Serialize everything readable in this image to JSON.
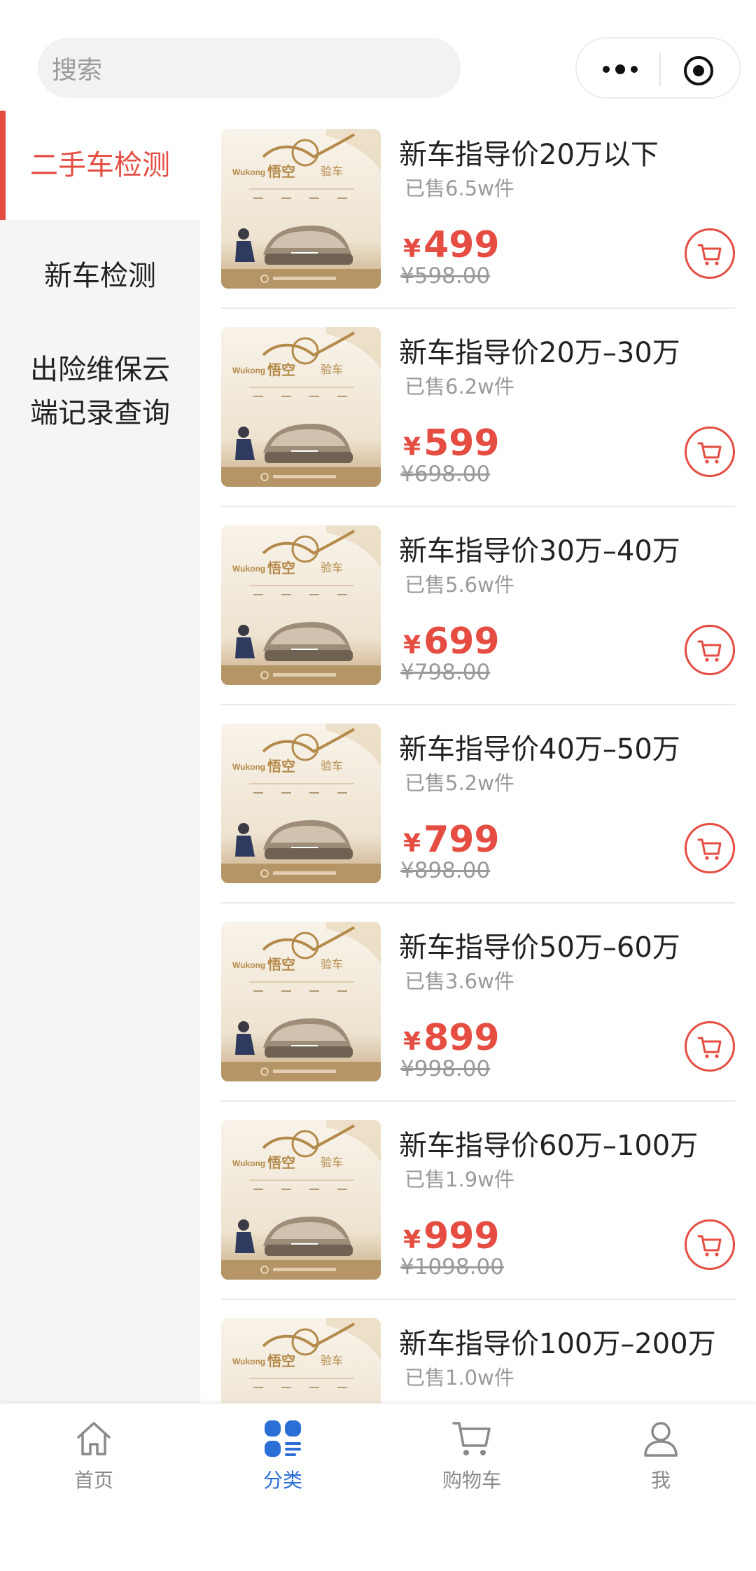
{
  "search": {
    "placeholder": "搜索"
  },
  "capsule": {
    "more_icon": "more-dots-icon",
    "close_icon": "target-icon"
  },
  "sidebar": {
    "items": [
      {
        "label": "二手车检测",
        "active": true
      },
      {
        "label": "新车检测",
        "active": false
      },
      {
        "label": "出险维保云端记录查询",
        "line1": "出险维保云",
        "line2": "端记录查询",
        "active": false
      }
    ]
  },
  "products": [
    {
      "title": "新车指导价20万以下",
      "sold": "已售6.5w件",
      "currency": "¥",
      "price": "499",
      "original": "¥598.00"
    },
    {
      "title": "新车指导价20万–30万",
      "sold": "已售6.2w件",
      "currency": "¥",
      "price": "599",
      "original": "¥698.00"
    },
    {
      "title": "新车指导价30万–40万",
      "sold": "已售5.6w件",
      "currency": "¥",
      "price": "699",
      "original": "¥798.00"
    },
    {
      "title": "新车指导价40万–50万",
      "sold": "已售5.2w件",
      "currency": "¥",
      "price": "799",
      "original": "¥898.00"
    },
    {
      "title": "新车指导价50万–60万",
      "sold": "已售3.6w件",
      "currency": "¥",
      "price": "899",
      "original": "¥998.00"
    },
    {
      "title": "新车指导价60万–100万",
      "sold": "已售1.9w件",
      "currency": "¥",
      "price": "999",
      "original": "¥1098.00"
    },
    {
      "title": "新车指导价100万–200万",
      "sold": "已售1.0w件",
      "currency": "¥",
      "price": "",
      "original": ""
    }
  ],
  "thumbnail": {
    "brand_latin": "Wukong",
    "brand_cn": "悟空验车"
  },
  "tabbar": {
    "tabs": [
      {
        "label": "首页",
        "icon": "home-icon"
      },
      {
        "label": "分类",
        "icon": "category-icon",
        "active": true
      },
      {
        "label": "购物车",
        "icon": "cart-icon"
      },
      {
        "label": "我",
        "icon": "user-icon"
      }
    ]
  },
  "colors": {
    "accent": "#e54d42",
    "tab_active": "#2b6fd6",
    "muted": "#9a9a9a"
  }
}
